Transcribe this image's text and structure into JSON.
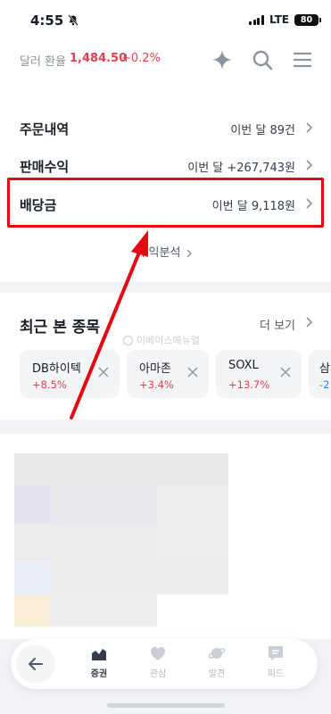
{
  "status_bar": {
    "time": "4:55",
    "network": "LTE",
    "battery": "80"
  },
  "header": {
    "rate_label": "달러 환율",
    "rate_value": "1,484.50",
    "rate_change": "+0.2%",
    "icons": [
      "sparkle-icon",
      "search-icon",
      "menu-icon"
    ]
  },
  "summary": {
    "orders": {
      "label": "주문내역",
      "value": "이번 달 89건"
    },
    "sales": {
      "label": "판매수익",
      "value": "이번 달 +267,743원"
    },
    "dividend": {
      "label": "배당금",
      "value": "이번 달 9,118원"
    },
    "analysis_link": "수익분석"
  },
  "recent": {
    "title": "최근 본 종목",
    "more": "더 보기",
    "watermark": "이베이스매뉴얼",
    "items": [
      {
        "name": "DB하이텍",
        "change": "+8.5%"
      },
      {
        "name": "아마존",
        "change": "+3.4%"
      },
      {
        "name": "SOXL",
        "change": "+13.7%"
      },
      {
        "name": "삼",
        "change": "-2"
      }
    ]
  },
  "bottom_nav": {
    "tabs": [
      {
        "label": "증권",
        "active": true
      },
      {
        "label": "관심",
        "active": false
      },
      {
        "label": "발견",
        "active": false
      },
      {
        "label": "피드",
        "active": false
      }
    ]
  },
  "colors": {
    "accent_red": "#e0404f",
    "highlight_red": "#e50914",
    "blue": "#3182f6"
  }
}
